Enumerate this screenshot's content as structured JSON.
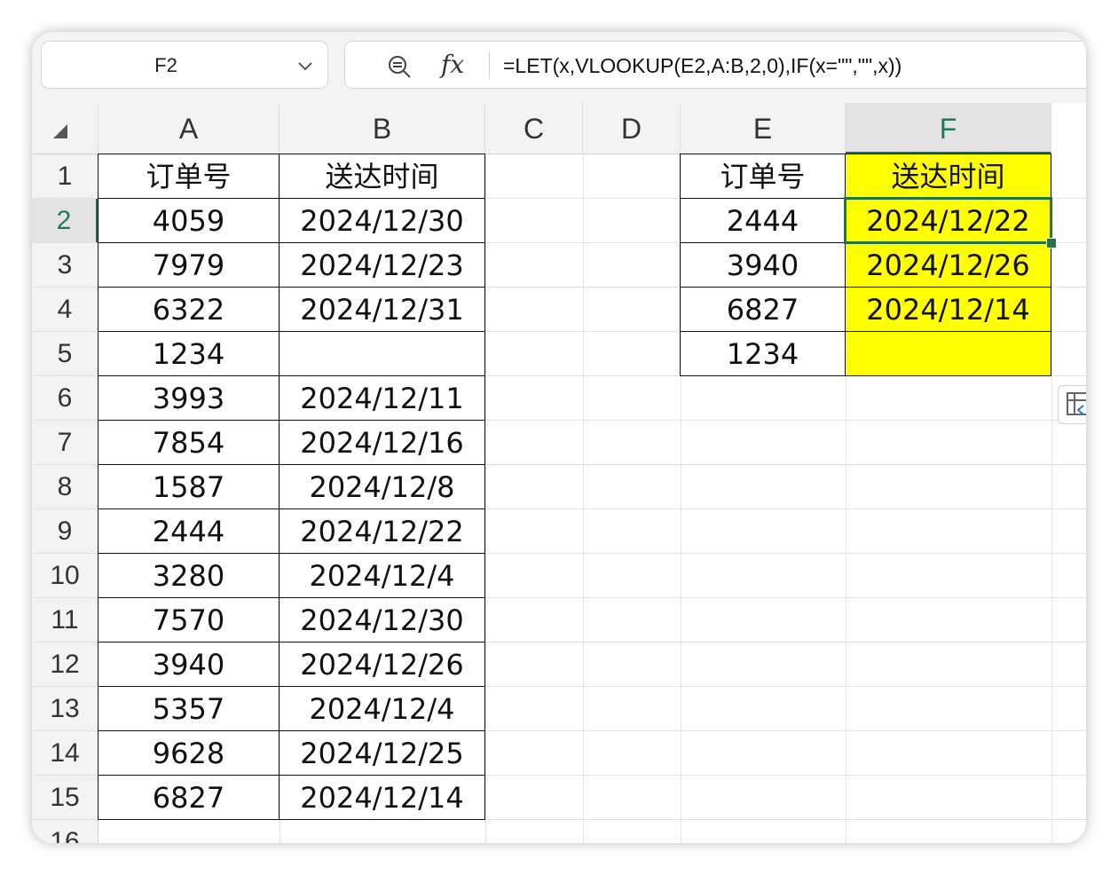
{
  "namebox": {
    "ref": "F2"
  },
  "formula_bar": {
    "fx_label": "fx",
    "formula": "=LET(x,VLOOKUP(E2,A:B,2,0),IF(x=\"\",\"\",x))"
  },
  "columns": [
    "A",
    "B",
    "C",
    "D",
    "E",
    "F"
  ],
  "active_column": "F",
  "rows": [
    "1",
    "2",
    "3",
    "4",
    "5",
    "6",
    "7",
    "8",
    "9",
    "10",
    "11",
    "12",
    "13",
    "14",
    "15",
    "16"
  ],
  "active_row": "2",
  "colors": {
    "selection": "#217346",
    "highlight": "#ffff00"
  },
  "left_table": {
    "headers": [
      "订单号",
      "送达时间"
    ],
    "rows": [
      [
        "4059",
        "2024/12/30"
      ],
      [
        "7979",
        "2024/12/23"
      ],
      [
        "6322",
        "2024/12/31"
      ],
      [
        "1234",
        ""
      ],
      [
        "3993",
        "2024/12/11"
      ],
      [
        "7854",
        "2024/12/16"
      ],
      [
        "1587",
        "2024/12/8"
      ],
      [
        "2444",
        "2024/12/22"
      ],
      [
        "3280",
        "2024/12/4"
      ],
      [
        "7570",
        "2024/12/30"
      ],
      [
        "3940",
        "2024/12/26"
      ],
      [
        "5357",
        "2024/12/4"
      ],
      [
        "9628",
        "2024/12/25"
      ],
      [
        "6827",
        "2024/12/14"
      ]
    ]
  },
  "right_table": {
    "headers": [
      "订单号",
      "送达时间"
    ],
    "rows": [
      [
        "2444",
        "2024/12/22"
      ],
      [
        "3940",
        "2024/12/26"
      ],
      [
        "6827",
        "2024/12/14"
      ],
      [
        "1234",
        ""
      ]
    ]
  },
  "icons": {
    "zoom": "zoom-out-icon",
    "chevron": "chevron-down-icon",
    "quick_analysis": "quick-analysis-icon"
  }
}
